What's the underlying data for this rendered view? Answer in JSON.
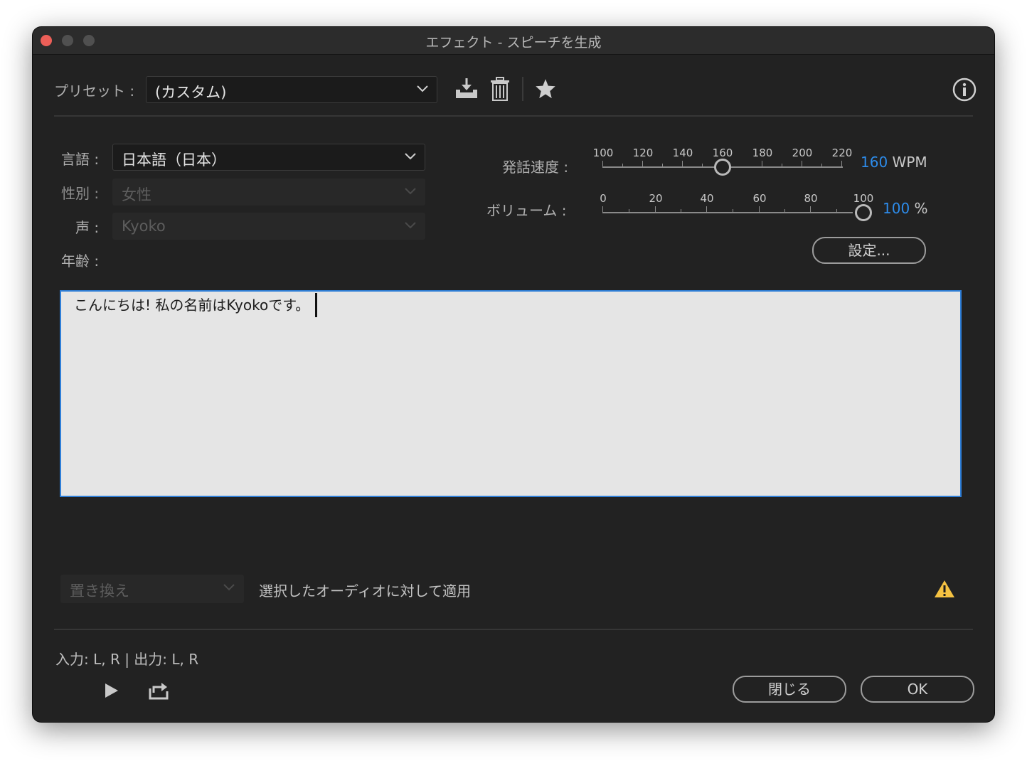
{
  "window": {
    "title": "エフェクト - スピーチを生成"
  },
  "preset": {
    "label": "プリセット :",
    "value": "(カスタム)"
  },
  "language": {
    "label": "言語 :",
    "value": "日本語（日本）"
  },
  "gender": {
    "label": "性別 :",
    "value": "女性"
  },
  "voice": {
    "label": "声 :",
    "value": "Kyoko"
  },
  "age": {
    "label": "年齢 :"
  },
  "speed": {
    "label": "発話速度 :",
    "scale": [
      "100",
      "120",
      "140",
      "160",
      "180",
      "200",
      "220"
    ],
    "value": "160",
    "unit": "WPM"
  },
  "volume": {
    "label": "ボリューム :",
    "scale": [
      "0",
      "20",
      "40",
      "60",
      "80",
      "100"
    ],
    "value": "100",
    "unit": "%"
  },
  "settings_button": "設定...",
  "text_input": {
    "value": "こんにちは! 私の名前はKyokoです。"
  },
  "apply": {
    "mode": "置き換え",
    "label": "選択したオーディオに対して適用"
  },
  "io_status": "入力: L, R | 出力: L, R",
  "buttons": {
    "close": "閉じる",
    "ok": "OK"
  },
  "colors": {
    "accent": "#2d8ceb",
    "warning": "#f5c242",
    "close_light": "#ec5f58"
  }
}
